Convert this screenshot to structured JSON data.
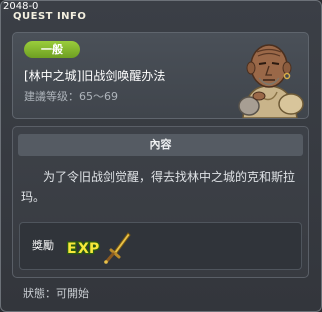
{
  "window": {
    "build_number": "2048-0",
    "title": "QUEST INFO"
  },
  "quest": {
    "category": "一般",
    "name": "[林中之城]旧战剑唤醒办法",
    "level_requirement": "建議等级：65～69",
    "npc_icon": "npc-portrait-icon"
  },
  "content": {
    "section_title": "內容",
    "description": "为了令旧战剑觉醒，得去找林中之城的克和斯拉玛。"
  },
  "reward": {
    "label": "獎勵",
    "items": [
      {
        "icon": "exp-icon"
      },
      {
        "icon": "sword-icon"
      }
    ]
  },
  "status": {
    "text": "狀態：可開始"
  },
  "colors": {
    "badge_green": "#84b82f",
    "panel": "#454a51",
    "text_light": "#ffffff"
  }
}
